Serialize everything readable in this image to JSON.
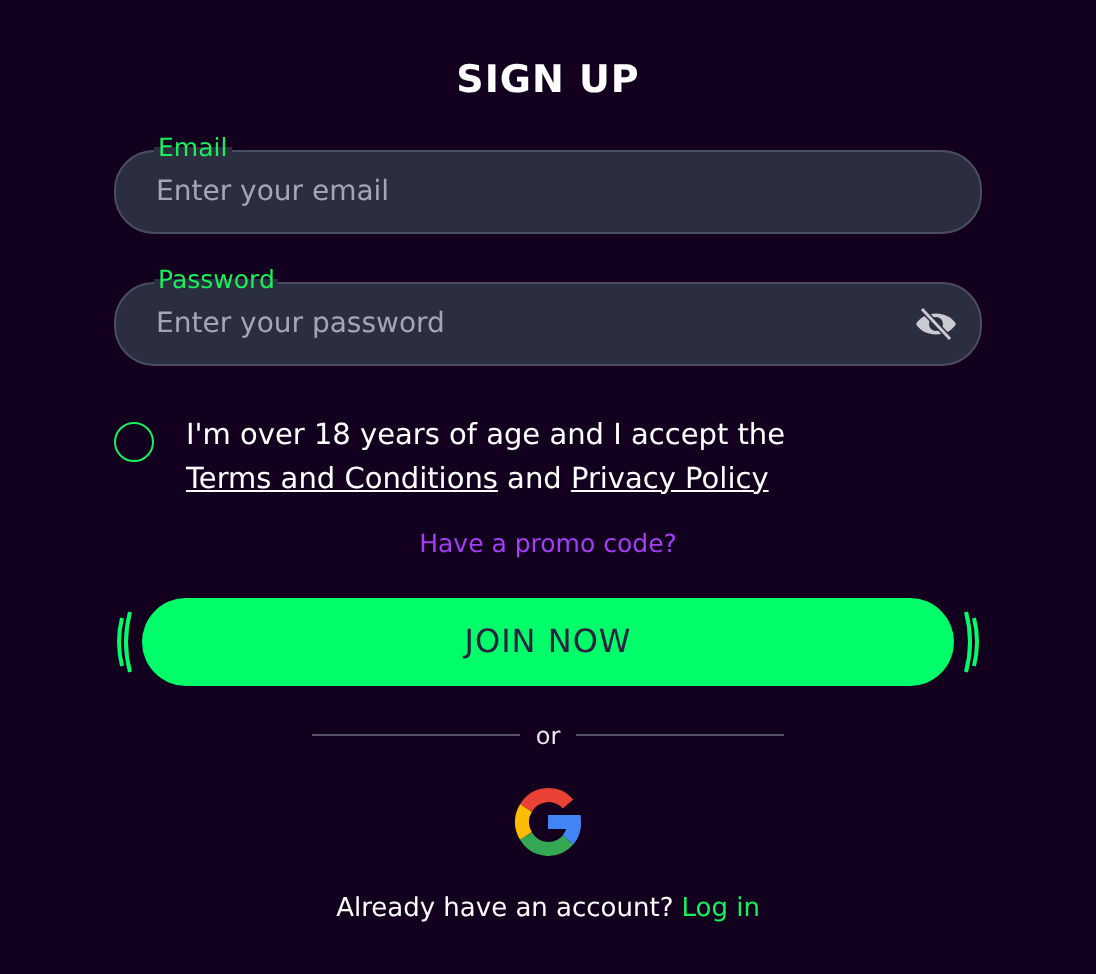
{
  "title": "SIGN UP",
  "fields": [
    {
      "label": "Email",
      "placeholder": "Enter your email",
      "kind": "text"
    },
    {
      "label": "Password",
      "placeholder": "Enter your password",
      "kind": "password"
    }
  ],
  "consent": {
    "checked": false,
    "parts": [
      {
        "kind": "text",
        "text": "I'm over 18 years of age and I accept the "
      },
      {
        "kind": "link",
        "text": "Terms and Conditions"
      },
      {
        "kind": "text",
        "text": " and "
      },
      {
        "kind": "link",
        "text": "Privacy Policy"
      }
    ]
  },
  "promo_link": "Have a promo code?",
  "join_button": "JOIN NOW",
  "divider_text": "or",
  "login_prompt": "Already have an account?",
  "login_link": "Log in"
}
